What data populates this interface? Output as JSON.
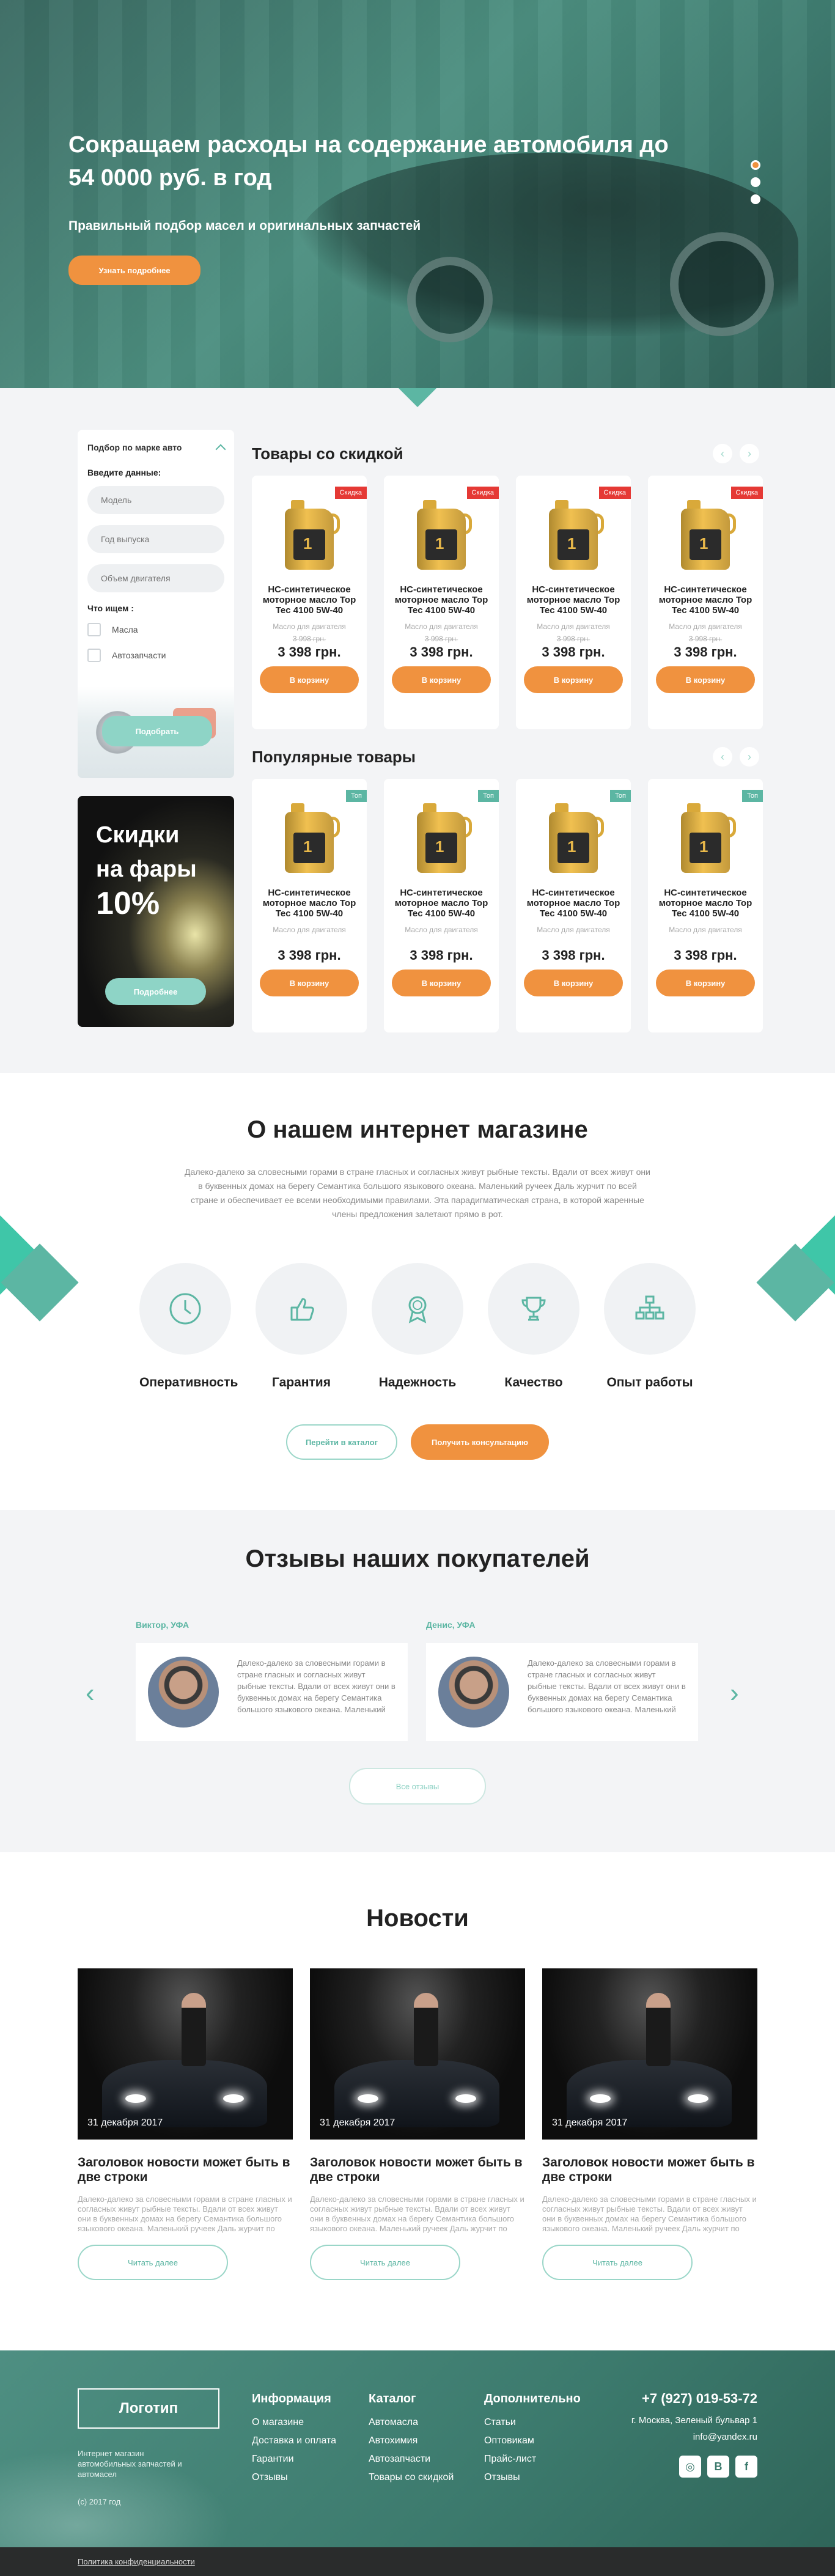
{
  "hero": {
    "title": "Сокращаем расходы на содержание автомобиля до 54 0000 руб. в год",
    "subtitle": "Правильный подбор масел и оригинальных запчастей",
    "cta": "Узнать подробнее",
    "slides": 3,
    "active_slide": 1
  },
  "filter": {
    "title": "Подбор по марке авто",
    "enter_label": "Введите данные:",
    "model_placeholder": "Модель",
    "year_placeholder": "Год выпуска",
    "engine_placeholder": "Объем двигателя",
    "search_label": "Что ищем :",
    "options": [
      "Масла",
      "Автозапчасти"
    ],
    "button": "Подобрать"
  },
  "promo": {
    "line1": "Скидки",
    "line2": "на фары",
    "line3": "10%",
    "button": "Подробнее"
  },
  "sale": {
    "title": "Товары со скидкой",
    "products": [
      {
        "badge": "Скидка",
        "name": "HC-синтетическое моторное масло Top Tec 4100 5W-40",
        "category": "Масло для двигателя",
        "old_price": "3 998 грн.",
        "price": "3 398 грн.",
        "button": "В корзину"
      },
      {
        "badge": "Скидка",
        "name": "HC-синтетическое моторное масло Top Tec 4100 5W-40",
        "category": "Масло для двигателя",
        "old_price": "3 998 грн.",
        "price": "3 398 грн.",
        "button": "В корзину"
      },
      {
        "badge": "Скидка",
        "name": "HC-синтетическое моторное масло Top Tec 4100 5W-40",
        "category": "Масло для двигателя",
        "old_price": "3 998 грн.",
        "price": "3 398 грн.",
        "button": "В корзину"
      },
      {
        "badge": "Скидка",
        "name": "HC-синтетическое моторное масло Top Tec 4100 5W-40",
        "category": "Масло для двигателя",
        "old_price": "3 998 грн.",
        "price": "3 398 грн.",
        "button": "В корзину"
      }
    ]
  },
  "popular": {
    "title": "Популярные товары",
    "products": [
      {
        "badge": "Топ",
        "name": "HC-синтетическое моторное масло Top Tec 4100 5W-40",
        "category": "Масло для двигателя",
        "price": "3 398 грн.",
        "button": "В корзину"
      },
      {
        "badge": "Топ",
        "name": "HC-синтетическое моторное масло Top Tec 4100 5W-40",
        "category": "Масло для двигателя",
        "price": "3 398 грн.",
        "button": "В корзину"
      },
      {
        "badge": "Топ",
        "name": "HC-синтетическое моторное масло Top Tec 4100 5W-40",
        "category": "Масло для двигателя",
        "price": "3 398 грн.",
        "button": "В корзину"
      },
      {
        "badge": "Топ",
        "name": "HC-синтетическое моторное масло Top Tec 4100 5W-40",
        "category": "Масло для двигателя",
        "price": "3 398 грн.",
        "button": "В корзину"
      }
    ]
  },
  "about": {
    "title": "О нашем интернет магазине",
    "text": "Далеко-далеко за словесными горами в стране гласных и согласных живут рыбные тексты. Вдали от всех живут они в буквенных домах на берегу Семантика большого языкового океана. Маленький ручеек Даль журчит по всей стране и обеспечивает ее всеми необходимыми правилами. Эта парадигматическая страна, в которой жаренные члены предложения залетают прямо в рот.",
    "features": [
      "Оперативность",
      "Гарантия",
      "Надежность",
      "Качество",
      "Опыт работы"
    ],
    "catalog_button": "Перейти в каталог",
    "consult_button": "Получить консультацию"
  },
  "reviews": {
    "title": "Отзывы наших покупателей",
    "items": [
      {
        "author": "Виктор, УФА",
        "text": "Далеко-далеко за словесными горами в стране гласных и согласных живут рыбные тексты. Вдали от всех живут они в буквенных домах на берегу Семантика большого языкового океана. Маленький"
      },
      {
        "author": "Денис, УФА",
        "text": "Далеко-далеко за словесными горами в стране гласных и согласных живут рыбные тексты. Вдали от всех живут они в буквенных домах на берегу Семантика большого языкового океана. Маленький"
      }
    ],
    "all_button": "Все отзывы"
  },
  "news": {
    "title": "Новости",
    "items": [
      {
        "date": "31 декабря 2017",
        "title": "Заголовок новости может быть в две строки",
        "text": "Далеко-далеко за словесными горами в стране гласных и согласных живут рыбные тексты. Вдали от всех живут они в буквенных домах на берегу Семантика большого языкового океана. Маленький ручеек Даль журчит по всей стране и обеспечивает ее всеми необходимыми",
        "button": "Читать далее"
      },
      {
        "date": "31 декабря 2017",
        "title": "Заголовок новости может быть в две строки",
        "text": "Далеко-далеко за словесными горами в стране гласных и согласных живут рыбные тексты. Вдали от всех живут они в буквенных домах на берегу Семантика большого языкового океана. Маленький ручеек Даль журчит по всей стране и обеспечивает ее всеми необходимыми",
        "button": "Читать далее"
      },
      {
        "date": "31 декабря 2017",
        "title": "Заголовок новости может быть в две строки",
        "text": "Далеко-далеко за словесными горами в стране гласных и согласных живут рыбные тексты. Вдали от всех живут они в буквенных домах на берегу Семантика большого языкового океана. Маленький ручеек Даль журчит по всей стране и обеспечивает ее всеми необходимыми",
        "button": "Читать далее"
      }
    ]
  },
  "footer": {
    "logo": "Логотип",
    "description": "Интернет магазин автомобильных запчастей и автомасел",
    "copyright": "(с) 2017 год",
    "columns": [
      {
        "title": "Информация",
        "links": [
          "О магазине",
          "Доставка и оплата",
          "Гарантии",
          "Отзывы"
        ]
      },
      {
        "title": "Каталог",
        "links": [
          "Автомасла",
          "Автохимия",
          "Автозапчасти",
          "Товары со скидкой"
        ]
      },
      {
        "title": "Дополнительно",
        "links": [
          "Статьи",
          "Оптовикам",
          "Прайс-лист",
          "Отзывы"
        ]
      }
    ],
    "phone": "+7 (927) 019-53-72",
    "address": "г. Москва, Зеленый бульвар 1",
    "email": "info@yandex.ru",
    "socials": [
      "instagram-icon",
      "vk-icon",
      "facebook-icon"
    ],
    "privacy": "Политика конфиденциальности"
  },
  "colors": {
    "accent": "#5cb6a3",
    "orange": "#f0923f",
    "sale_badge": "#e53935",
    "footer_bg": "#3c7a6d"
  }
}
